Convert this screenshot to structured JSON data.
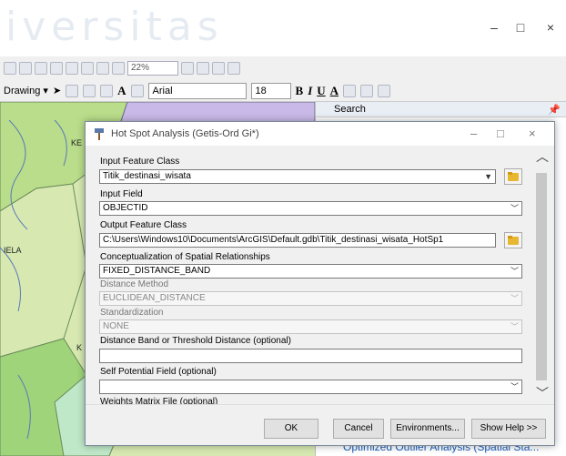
{
  "app": {
    "watermark": "iversitas",
    "window_controls": [
      "–",
      "□",
      "×"
    ]
  },
  "toolbar": {
    "zoom": "22%",
    "drawing_label": "Drawing ▾",
    "font_name": "Arial",
    "font_size": "18",
    "bold": "B",
    "italic": "I",
    "underline": "U",
    "font_color_letter": "A"
  },
  "map": {
    "labels": [
      "KE",
      "IELA",
      "K"
    ]
  },
  "search_panel": {
    "title": "Search",
    "bottom_link": "Optimized Outlier Analysis (Spatial Sta..."
  },
  "dialog": {
    "title": "Hot Spot Analysis (Getis-Ord Gi*)",
    "controls": [
      "–",
      "□",
      "×"
    ],
    "fields": {
      "input_feature_class": {
        "label": "Input Feature Class",
        "value": "Titik_destinasi_wisata"
      },
      "input_field": {
        "label": "Input Field",
        "value": "OBJECTID"
      },
      "output_feature_class": {
        "label": "Output Feature Class",
        "value": "C:\\Users\\Windows10\\Documents\\ArcGIS\\Default.gdb\\Titik_destinasi_wisata_HotSp1"
      },
      "conceptualization": {
        "label": "Conceptualization of Spatial Relationships",
        "value": "FIXED_DISTANCE_BAND"
      },
      "distance_method": {
        "label": "Distance Method",
        "value": "EUCLIDEAN_DISTANCE"
      },
      "standardization": {
        "label": "Standardization",
        "value": "NONE"
      },
      "distance_band": {
        "label": "Distance Band or Threshold Distance (optional)",
        "value": ""
      },
      "self_potential": {
        "label": "Self Potential Field (optional)",
        "value": ""
      },
      "weights_matrix": {
        "label": "Weights Matrix File (optional)",
        "value": ""
      }
    },
    "buttons": {
      "ok": "OK",
      "cancel": "Cancel",
      "environments": "Environments...",
      "show_help": "Show Help >>"
    }
  }
}
